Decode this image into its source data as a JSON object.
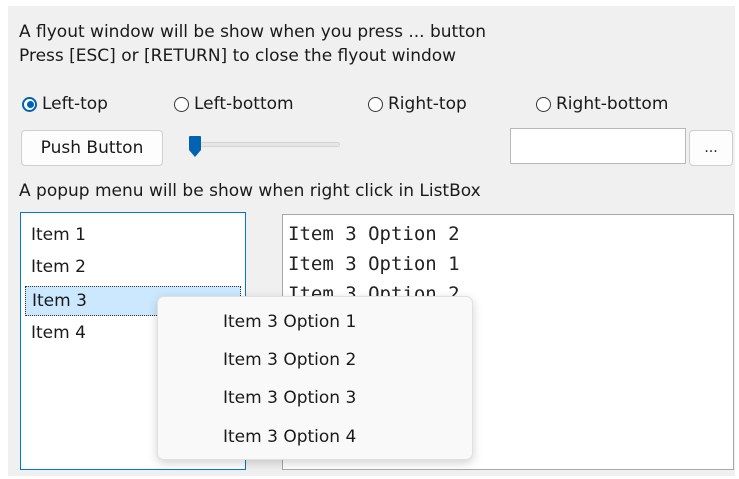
{
  "info": {
    "line1": "A flyout window will be show when you press ... button",
    "line2": "Press [ESC] or [RETURN] to close the flyout window",
    "popup_hint": "A popup menu will be show when right click in ListBox"
  },
  "radios": [
    {
      "label": "Left-top",
      "checked": true
    },
    {
      "label": "Left-bottom",
      "checked": false
    },
    {
      "label": "Right-top",
      "checked": false
    },
    {
      "label": "Right-bottom",
      "checked": false
    }
  ],
  "push_button": {
    "label": "Push Button"
  },
  "slider": {
    "value": 0
  },
  "edit": {
    "value": ""
  },
  "ellipsis_button": {
    "label": "..."
  },
  "listbox": {
    "items": [
      "Item 1",
      "Item 2",
      "Item 3",
      "Item 4"
    ],
    "selected_index": 2
  },
  "textbox": {
    "lines": [
      "Item 3 Option 2",
      "Item 3 Option 1",
      "Item 3 Option 2"
    ]
  },
  "popup_menu": {
    "items": [
      "Item 3 Option 1",
      "Item 3 Option 2",
      "Item 3 Option 3",
      "Item 3 Option 4"
    ]
  },
  "colors": {
    "accent": "#0078d4",
    "selection": "#cce8ff",
    "background": "#f0f0f0"
  }
}
